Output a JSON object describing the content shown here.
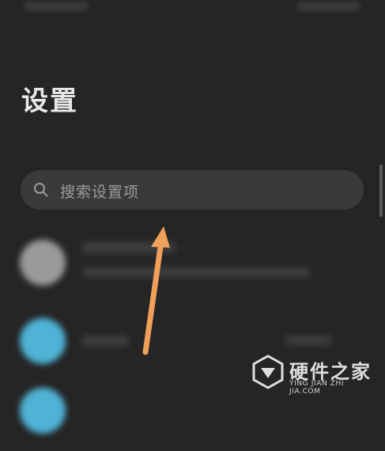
{
  "header": {
    "title": "设置"
  },
  "search": {
    "placeholder": "搜索设置项"
  },
  "watermark": {
    "name": "硬件之家",
    "subtitle": "YING JIAN ZHI JIA.COM"
  },
  "colors": {
    "background": "#252525",
    "search_bg": "#3a3a3a",
    "arrow": "#f0a05a",
    "item_icon_1": "#9a9a9a",
    "item_icon_2": "#4fb3d6"
  },
  "icons": {
    "search": "search-icon",
    "arrow": "annotation-arrow"
  }
}
